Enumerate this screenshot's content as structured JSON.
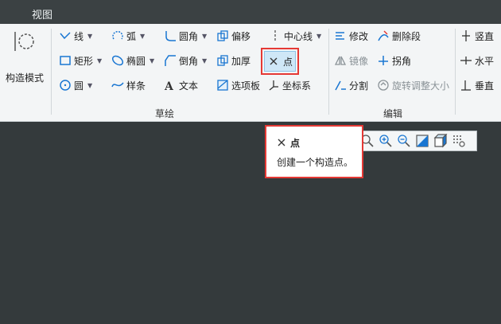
{
  "menubar": {
    "view": "视图"
  },
  "sketch_group": {
    "label": "草绘",
    "construction_mode": "构造模式",
    "line": "线",
    "arc": "弧",
    "fillet": "圆角",
    "offset": "偏移",
    "centerline": "中心线",
    "rectangle": "矩形",
    "ellipse": "椭圆",
    "chamfer": "倒角",
    "thicken": "加厚",
    "point": "点",
    "circle": "圆",
    "spline": "样条",
    "text": "文本",
    "palette": "选项板",
    "coordinate_system": "坐标系"
  },
  "edit_group": {
    "label": "编辑",
    "modify": "修改",
    "delete_segment": "删除段",
    "mirror": "镜像",
    "corner": "拐角",
    "divide": "分割",
    "rotate_resize": "旋转调整大小"
  },
  "constrain_group": {
    "vertical": "竖直",
    "horizontal": "水平",
    "perpendicular": "垂直"
  },
  "tooltip": {
    "title": "点",
    "description": "创建一个构造点。"
  },
  "colors": {
    "highlight": "#e53935",
    "active_bg": "#cfe7f7",
    "accent": "#1976d2",
    "canvas": "#343a3c"
  }
}
